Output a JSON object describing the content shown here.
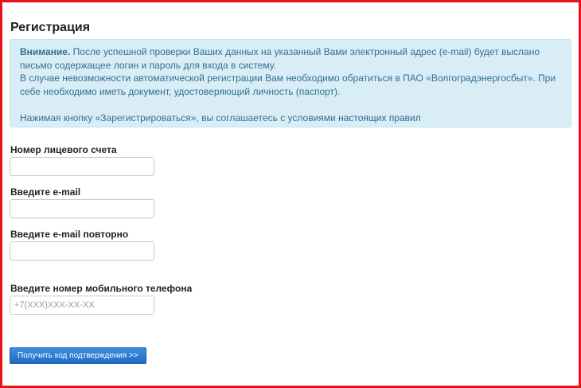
{
  "page": {
    "title": "Регистрация"
  },
  "notice": {
    "attention_label": "Внимание.",
    "text_1": " После успешной проверки Ваших данных на указанный Вами электронный адрес (e-mail) будет выслано письмо содержащее логин и пароль для входа в систему.",
    "text_2": "В случае невозможности автоматической регистрации Вам необходимо обратиться в ПАО «Волгоградэнергосбыт». При себе необходимо иметь документ, удостоверяющий личность (паспорт).",
    "agreement_text": "Нажимая кнопку «Зарегистрироваться», вы соглашаетесь с условиями ",
    "rules_link": "настоящих правил"
  },
  "form": {
    "account_label": "Номер лицевого счета",
    "account_value": "",
    "email_label": "Введите e-mail",
    "email_value": "",
    "email_repeat_label": "Введите e-mail повторно",
    "email_repeat_value": "",
    "phone_label": "Введите номер мобильного телефона",
    "phone_placeholder": "+7(XXX)XXX-XX-XX",
    "submit_label": "Получить код подтверждения >>"
  },
  "colors": {
    "frame_border": "#e8141b",
    "notice_background": "#d9edf7",
    "notice_text": "#31708f",
    "button_background": "#1e6cc4"
  }
}
